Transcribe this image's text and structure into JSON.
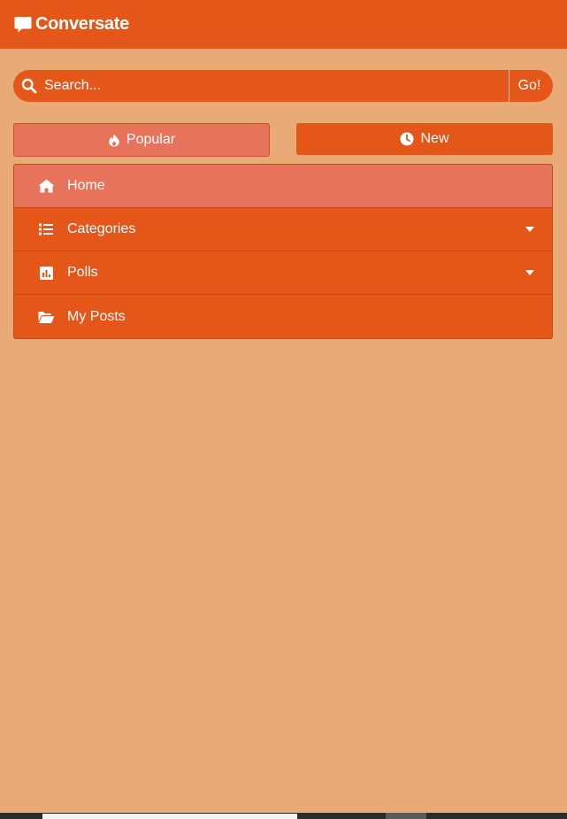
{
  "header": {
    "brand_name": "Conversate",
    "brand_icon": "comment-icon"
  },
  "search": {
    "placeholder": "Search...",
    "value": "",
    "icon": "search-icon",
    "go_label": "Go!"
  },
  "sort": {
    "popular_label": "Popular",
    "popular_icon": "fire-icon",
    "new_label": "New",
    "new_icon": "clock-icon"
  },
  "menu": {
    "items": [
      {
        "label": "Home",
        "icon": "home-icon",
        "active": true,
        "has_dropdown": false
      },
      {
        "label": "Categories",
        "icon": "list-icon",
        "active": false,
        "has_dropdown": true
      },
      {
        "label": "Polls",
        "icon": "poll-icon",
        "active": false,
        "has_dropdown": true
      },
      {
        "label": "My Posts",
        "icon": "folder-open-icon",
        "active": false,
        "has_dropdown": false
      }
    ]
  },
  "colors": {
    "background": "#e8aa76",
    "primary": "#e55619",
    "active": "#e7735a",
    "text": "#ffffff"
  }
}
